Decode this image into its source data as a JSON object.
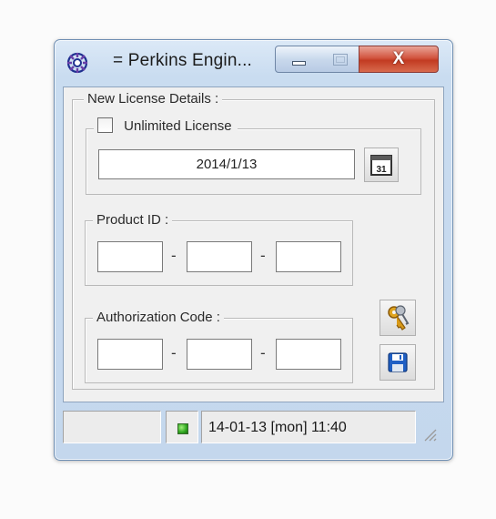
{
  "window": {
    "title": "= Perkins Engin...",
    "icon": "gear-app-icon"
  },
  "caption_buttons": {
    "minimize_icon": "minimize-icon",
    "maximize_icon": "maximize-icon",
    "close_glyph": "X"
  },
  "license_group": {
    "legend": "New License Details :",
    "unlimited_label": "Unlimited License",
    "unlimited_checked": false,
    "date_value": "2014/1/13",
    "calendar_icon_text": "31"
  },
  "product_id": {
    "legend": "Product ID :",
    "separator": "-",
    "parts": [
      "",
      "",
      ""
    ]
  },
  "authorization": {
    "legend": "Authorization Code :",
    "separator": "-",
    "parts": [
      "",
      "",
      ""
    ]
  },
  "tools": {
    "keys_icon": "keys-icon",
    "save_icon": "save-icon"
  },
  "status": {
    "led_color": "#2ea51f",
    "datetime": "14-01-13  [mon]  11:40"
  }
}
